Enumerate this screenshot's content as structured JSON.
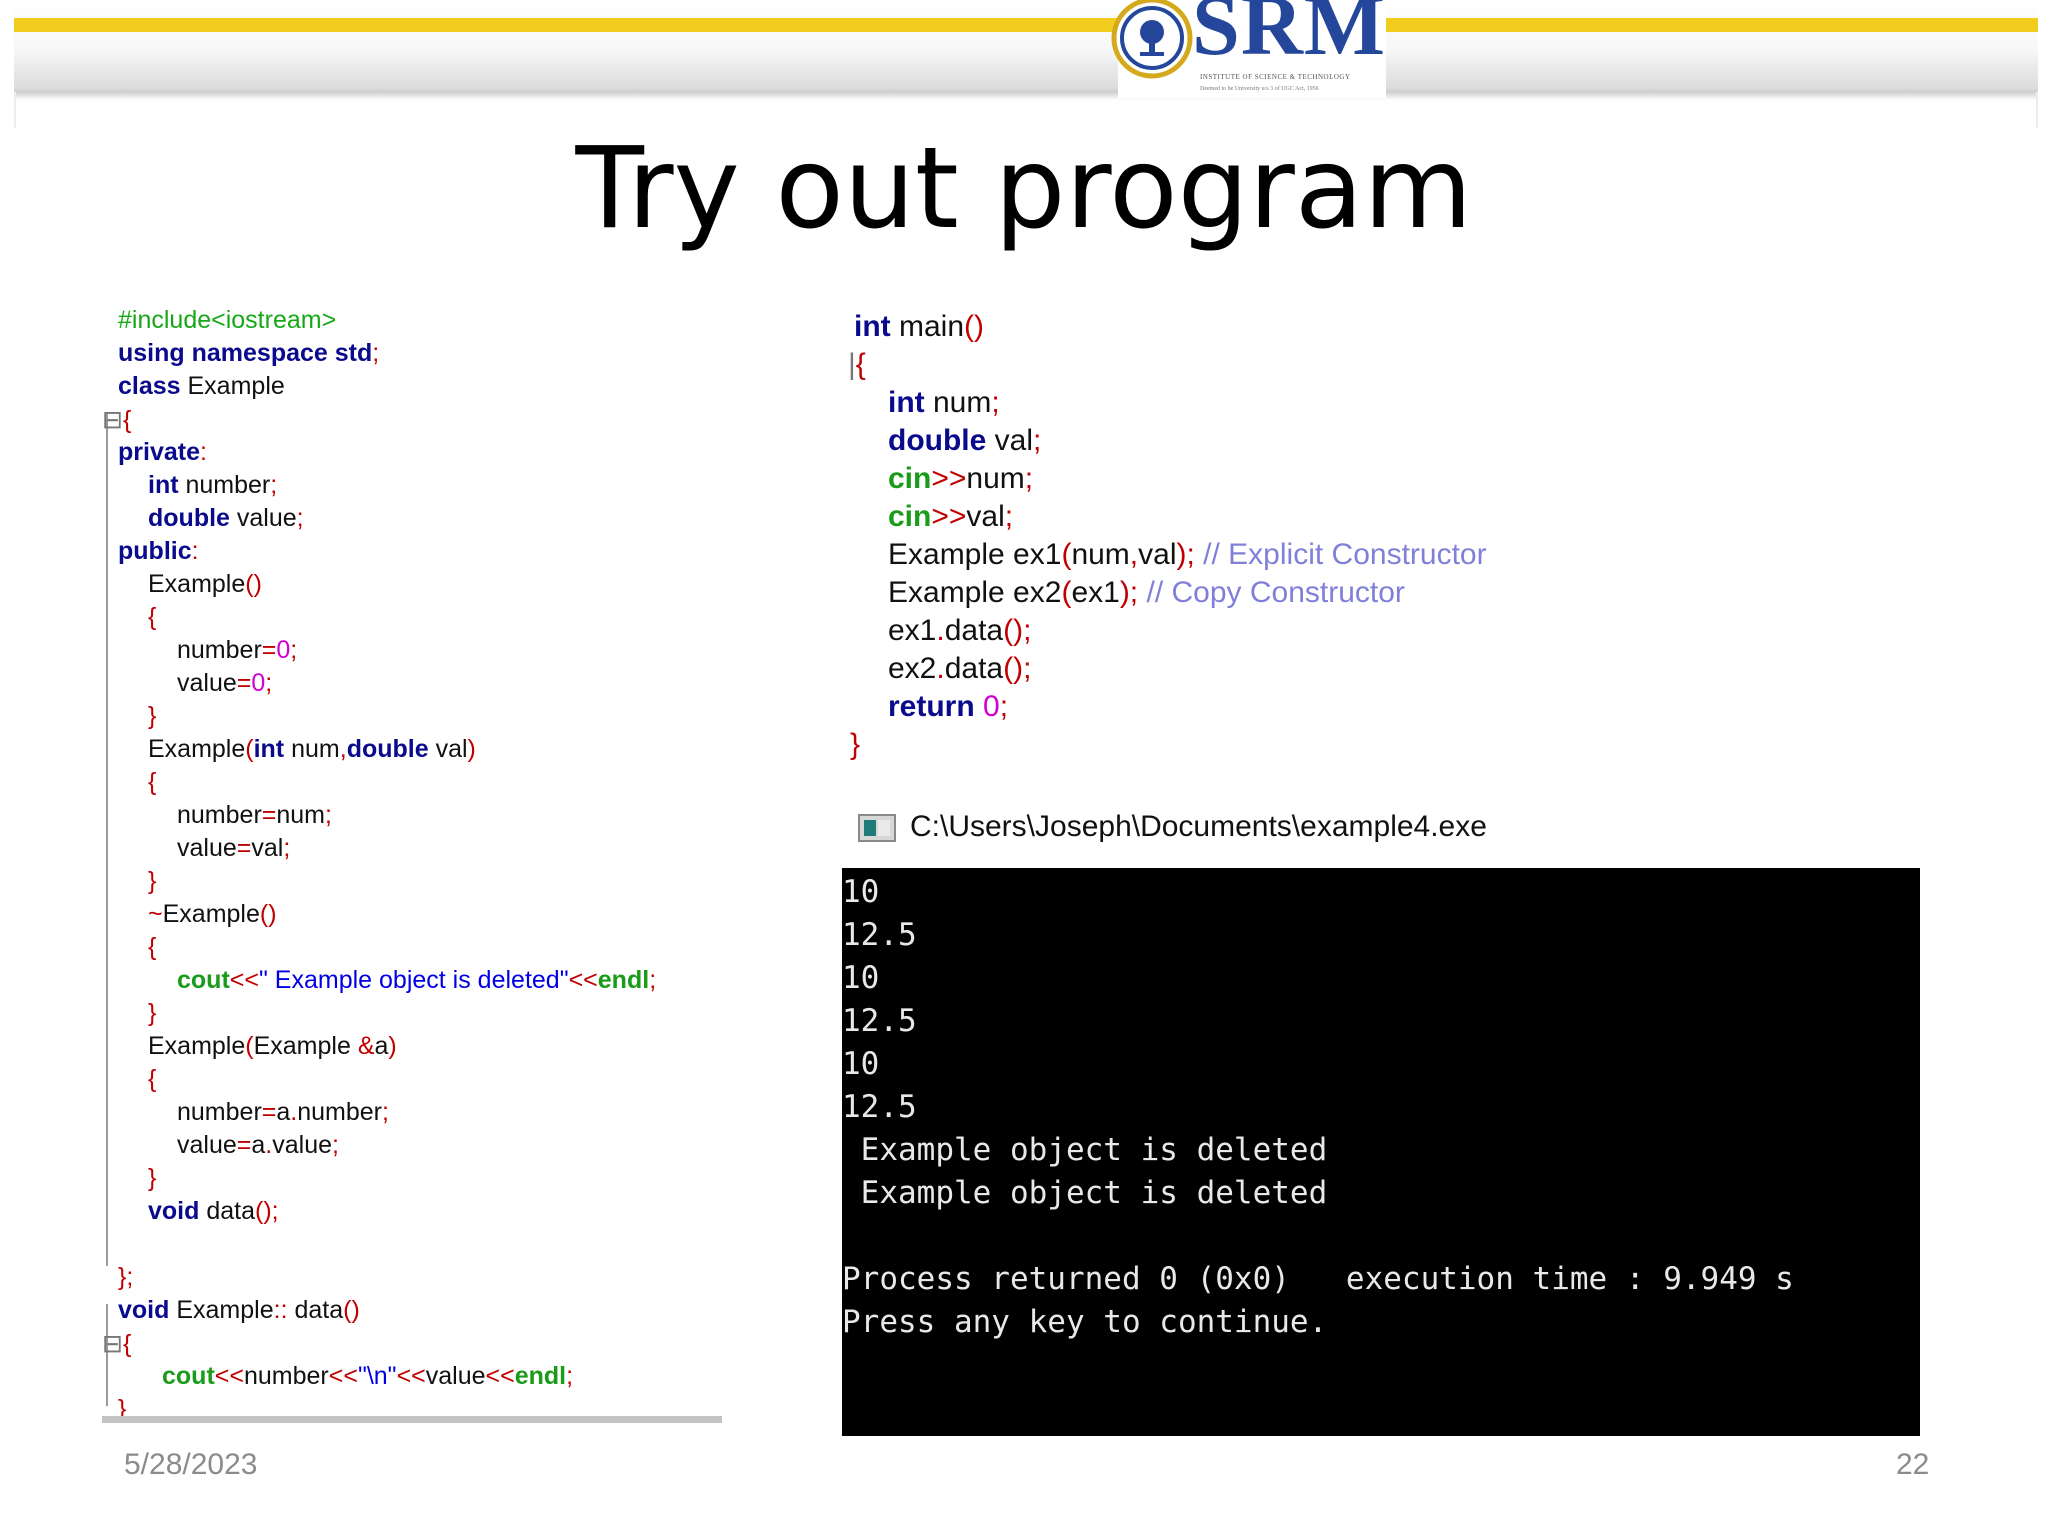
{
  "logo": {
    "text": "SRM",
    "line1": "INSTITUTE OF SCIENCE & TECHNOLOGY",
    "line2": "Deemed to be University u/s 3 of UGC Act, 1956"
  },
  "slide": {
    "title": "Try out program",
    "date": "5/28/2023",
    "page": "22"
  },
  "colors": {
    "header_stripe": "#f2cc1e",
    "logo_blue": "#24469b",
    "console_bg": "#000000"
  },
  "console": {
    "title": "C:\\Users\\Joseph\\Documents\\example4.exe",
    "icon": "console-window-icon",
    "lines": [
      "10",
      "12.5",
      "10",
      "12.5",
      "10",
      "12.5",
      " Example object is deleted",
      " Example object is deleted",
      "",
      "Process returned 0 (0x0)   execution time : 9.949 s",
      "Press any key to continue."
    ]
  }
}
